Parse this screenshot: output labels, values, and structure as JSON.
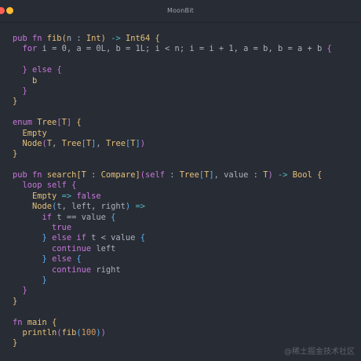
{
  "window": {
    "title": "MoonBit"
  },
  "code_lines": [
    [
      {
        "t": "pub fn ",
        "c": "k"
      },
      {
        "t": "fib",
        "c": "f"
      },
      {
        "t": "(",
        "c": "b1"
      },
      {
        "t": "n",
        "c": "p"
      },
      {
        "t": " : ",
        "c": "p"
      },
      {
        "t": "Int",
        "c": "t"
      },
      {
        "t": ")",
        "c": "b1"
      },
      {
        "t": " -> ",
        "c": "o"
      },
      {
        "t": "Int64",
        "c": "t"
      },
      {
        "t": " {",
        "c": "b1"
      }
    ],
    [
      {
        "t": "  ",
        "c": "p"
      },
      {
        "t": "for ",
        "c": "k"
      },
      {
        "t": "i",
        "c": "p"
      },
      {
        "t": " = ",
        "c": "p"
      },
      {
        "t": "0",
        "c": "p"
      },
      {
        "t": ", ",
        "c": "p"
      },
      {
        "t": "a",
        "c": "p"
      },
      {
        "t": " = ",
        "c": "p"
      },
      {
        "t": "0L",
        "c": "p"
      },
      {
        "t": ", ",
        "c": "p"
      },
      {
        "t": "b",
        "c": "p"
      },
      {
        "t": " = ",
        "c": "p"
      },
      {
        "t": "1L",
        "c": "p"
      },
      {
        "t": "; ",
        "c": "p"
      },
      {
        "t": "i < n",
        "c": "p"
      },
      {
        "t": "; ",
        "c": "p"
      },
      {
        "t": "i = i + 1",
        "c": "p"
      },
      {
        "t": ", ",
        "c": "p"
      },
      {
        "t": "a = b",
        "c": "p"
      },
      {
        "t": ", ",
        "c": "p"
      },
      {
        "t": "b = a + b",
        "c": "p"
      },
      {
        "t": " {",
        "c": "b2"
      }
    ],
    [
      {
        "t": "",
        "c": "p"
      }
    ],
    [
      {
        "t": "  ",
        "c": "p"
      },
      {
        "t": "}",
        "c": "b2"
      },
      {
        "t": " else ",
        "c": "k"
      },
      {
        "t": "{",
        "c": "b2"
      }
    ],
    [
      {
        "t": "    b",
        "c": "f"
      }
    ],
    [
      {
        "t": "  ",
        "c": "p"
      },
      {
        "t": "}",
        "c": "b2"
      }
    ],
    [
      {
        "t": "}",
        "c": "b1"
      }
    ],
    [
      {
        "t": "",
        "c": "p"
      }
    ],
    [
      {
        "t": "enum ",
        "c": "k"
      },
      {
        "t": "Tree",
        "c": "f"
      },
      {
        "t": "[",
        "c": "b2"
      },
      {
        "t": "T",
        "c": "t"
      },
      {
        "t": "]",
        "c": "b2"
      },
      {
        "t": " {",
        "c": "b1"
      }
    ],
    [
      {
        "t": "  Empty",
        "c": "f"
      }
    ],
    [
      {
        "t": "  Node",
        "c": "f"
      },
      {
        "t": "(",
        "c": "b2"
      },
      {
        "t": "T",
        "c": "t"
      },
      {
        "t": ", ",
        "c": "p"
      },
      {
        "t": "Tree",
        "c": "t"
      },
      {
        "t": "[",
        "c": "b3"
      },
      {
        "t": "T",
        "c": "t"
      },
      {
        "t": "]",
        "c": "b3"
      },
      {
        "t": ", ",
        "c": "p"
      },
      {
        "t": "Tree",
        "c": "t"
      },
      {
        "t": "[",
        "c": "b3"
      },
      {
        "t": "T",
        "c": "t"
      },
      {
        "t": "]",
        "c": "b3"
      },
      {
        "t": ")",
        "c": "b2"
      }
    ],
    [
      {
        "t": "}",
        "c": "b1"
      }
    ],
    [
      {
        "t": "",
        "c": "p"
      }
    ],
    [
      {
        "t": "pub fn ",
        "c": "k"
      },
      {
        "t": "search",
        "c": "f"
      },
      {
        "t": "[",
        "c": "b1"
      },
      {
        "t": "T",
        "c": "t"
      },
      {
        "t": " : ",
        "c": "p"
      },
      {
        "t": "Compare",
        "c": "t"
      },
      {
        "t": "]",
        "c": "b1"
      },
      {
        "t": "(",
        "c": "b2"
      },
      {
        "t": "self",
        "c": "k"
      },
      {
        "t": " : ",
        "c": "p"
      },
      {
        "t": "Tree",
        "c": "t"
      },
      {
        "t": "[",
        "c": "b3"
      },
      {
        "t": "T",
        "c": "t"
      },
      {
        "t": "]",
        "c": "b3"
      },
      {
        "t": ", ",
        "c": "p"
      },
      {
        "t": "value",
        "c": "p"
      },
      {
        "t": " : ",
        "c": "p"
      },
      {
        "t": "T",
        "c": "t"
      },
      {
        "t": ")",
        "c": "b2"
      },
      {
        "t": " -> ",
        "c": "o"
      },
      {
        "t": "Bool",
        "c": "t"
      },
      {
        "t": " {",
        "c": "b1"
      }
    ],
    [
      {
        "t": "  ",
        "c": "p"
      },
      {
        "t": "loop ",
        "c": "k"
      },
      {
        "t": "self ",
        "c": "k"
      },
      {
        "t": "{",
        "c": "b2"
      }
    ],
    [
      {
        "t": "    ",
        "c": "p"
      },
      {
        "t": "Empty",
        "c": "f"
      },
      {
        "t": " => ",
        "c": "o"
      },
      {
        "t": "false",
        "c": "k"
      }
    ],
    [
      {
        "t": "    ",
        "c": "p"
      },
      {
        "t": "Node",
        "c": "f"
      },
      {
        "t": "(",
        "c": "b3"
      },
      {
        "t": "t, left, right",
        "c": "p"
      },
      {
        "t": ")",
        "c": "b3"
      },
      {
        "t": " =>",
        "c": "o"
      }
    ],
    [
      {
        "t": "      ",
        "c": "p"
      },
      {
        "t": "if ",
        "c": "k"
      },
      {
        "t": "t == value ",
        "c": "p"
      },
      {
        "t": "{",
        "c": "b3"
      }
    ],
    [
      {
        "t": "        ",
        "c": "p"
      },
      {
        "t": "true",
        "c": "k"
      }
    ],
    [
      {
        "t": "      ",
        "c": "p"
      },
      {
        "t": "}",
        "c": "b3"
      },
      {
        "t": " else if ",
        "c": "k"
      },
      {
        "t": "t < value ",
        "c": "p"
      },
      {
        "t": "{",
        "c": "b3"
      }
    ],
    [
      {
        "t": "        ",
        "c": "p"
      },
      {
        "t": "continue ",
        "c": "k"
      },
      {
        "t": "left",
        "c": "p"
      }
    ],
    [
      {
        "t": "      ",
        "c": "p"
      },
      {
        "t": "}",
        "c": "b3"
      },
      {
        "t": " else ",
        "c": "k"
      },
      {
        "t": "{",
        "c": "b3"
      }
    ],
    [
      {
        "t": "        ",
        "c": "p"
      },
      {
        "t": "continue ",
        "c": "k"
      },
      {
        "t": "right",
        "c": "p"
      }
    ],
    [
      {
        "t": "      ",
        "c": "p"
      },
      {
        "t": "}",
        "c": "b3"
      }
    ],
    [
      {
        "t": "  ",
        "c": "p"
      },
      {
        "t": "}",
        "c": "b2"
      }
    ],
    [
      {
        "t": "}",
        "c": "b1"
      }
    ],
    [
      {
        "t": "",
        "c": "p"
      }
    ],
    [
      {
        "t": "fn ",
        "c": "k"
      },
      {
        "t": "main",
        "c": "f"
      },
      {
        "t": " {",
        "c": "b1"
      }
    ],
    [
      {
        "t": "  ",
        "c": "p"
      },
      {
        "t": "println",
        "c": "f"
      },
      {
        "t": "(",
        "c": "b2"
      },
      {
        "t": "fib",
        "c": "f"
      },
      {
        "t": "(",
        "c": "b3"
      },
      {
        "t": "100",
        "c": "n"
      },
      {
        "t": ")",
        "c": "b3"
      },
      {
        "t": ")",
        "c": "b2"
      }
    ],
    [
      {
        "t": "}",
        "c": "b1"
      }
    ]
  ],
  "watermark": "@稀土掘金技术社区",
  "colors": {
    "background": "#282c34",
    "keyword": "#c678dd",
    "type": "#e5c07b",
    "operator": "#56b6c2",
    "bracket_blue": "#61afef",
    "text": "#abb2bf"
  }
}
